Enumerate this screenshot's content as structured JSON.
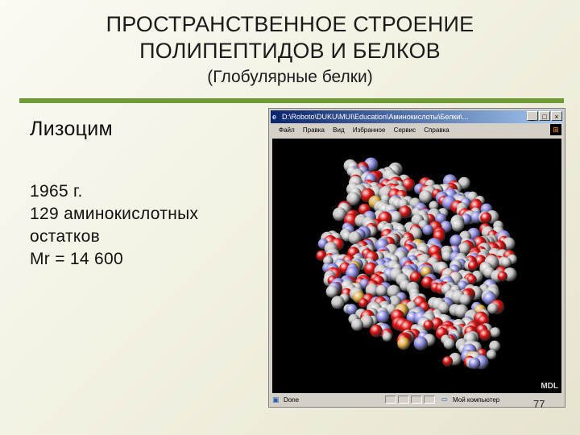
{
  "slide": {
    "title_line1": "ПРОСТРАНСТВЕННОЕ СТРОЕНИЕ",
    "title_line2": "ПОЛИПЕПТИДОВ И БЕЛКОВ",
    "subtitle": "(Глобулярные белки)",
    "heading": "Лизоцим",
    "facts": [
      "1965 г.",
      "129 аминокислотных",
      "остатков",
      "Mr = 14 600"
    ],
    "page_number": "77",
    "rule_color": "#6f9a36"
  },
  "browser": {
    "title_path": "D:\\Roboto\\DUKU\\MUI\\Education\\Аминокислоты\\Белки\\...",
    "menu": [
      "Файл",
      "Правка",
      "Вид",
      "Избранное",
      "Сервис",
      "Справка"
    ],
    "window_buttons": [
      "_",
      "□",
      "×"
    ],
    "status_text": "Done",
    "status_zone": "Мой компьютер",
    "viewer_watermark": "MDL",
    "icons": [
      "ie-icon",
      "windows-logo-icon",
      "page-done-icon",
      "computer-zone-icon"
    ]
  },
  "molecule": {
    "atom_colors": {
      "carbon": "#c9c9c9",
      "oxygen": "#e01010",
      "nitrogen": "#8f8fea",
      "sulfur": "#e7b342"
    }
  }
}
